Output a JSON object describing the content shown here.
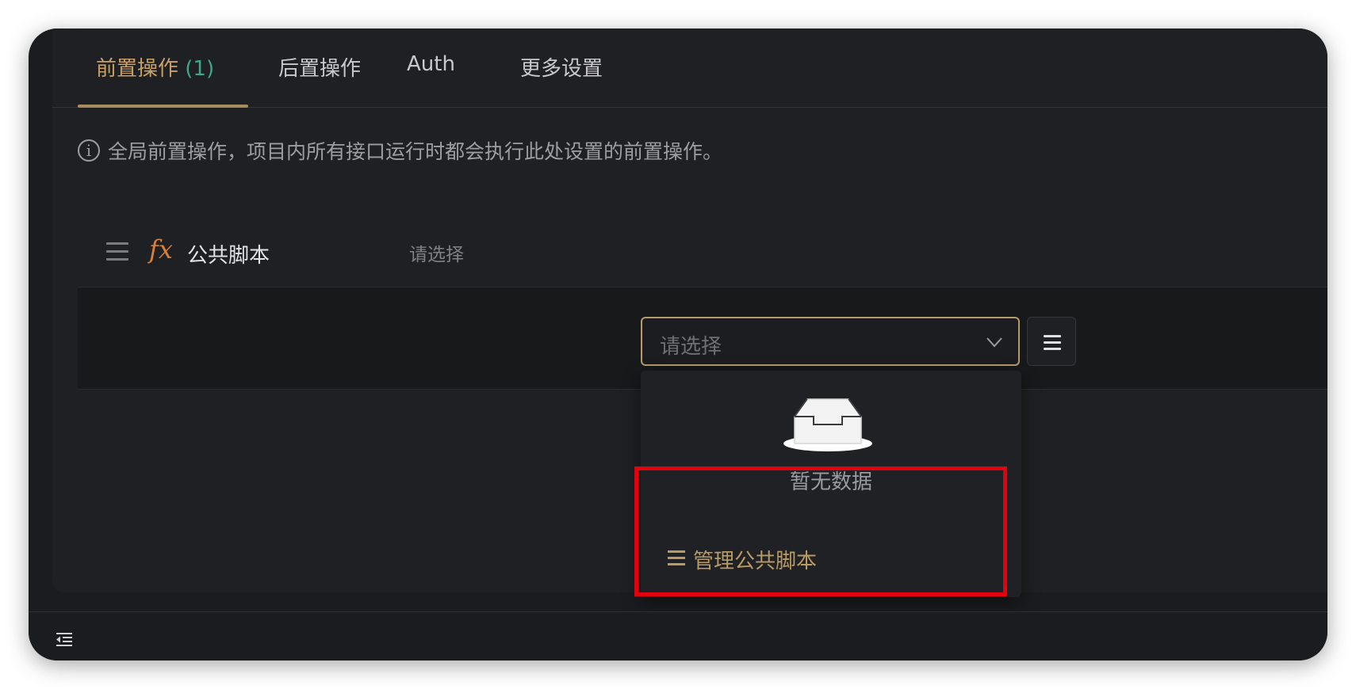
{
  "tabs": [
    {
      "label": "前置操作",
      "count": "(1)"
    },
    {
      "label": "后置操作"
    },
    {
      "label": "Auth"
    },
    {
      "label": "更多设置"
    }
  ],
  "info": {
    "icon": "info-icon",
    "icon_glyph": "i",
    "text": "全局前置操作，项目内所有接口运行时都会执行此处设置的前置操作。"
  },
  "row": {
    "fx_glyph": "fx",
    "label": "公共脚本",
    "placeholder": "请选择"
  },
  "select": {
    "placeholder": "请选择"
  },
  "dropdown": {
    "empty_text": "暂无数据",
    "manage_label": "管理公共脚本"
  },
  "colors": {
    "accent": "#c9a064",
    "count": "#3ea88a",
    "fx": "#d7803c",
    "highlight": "#e3000f",
    "background": "#1f2023"
  }
}
